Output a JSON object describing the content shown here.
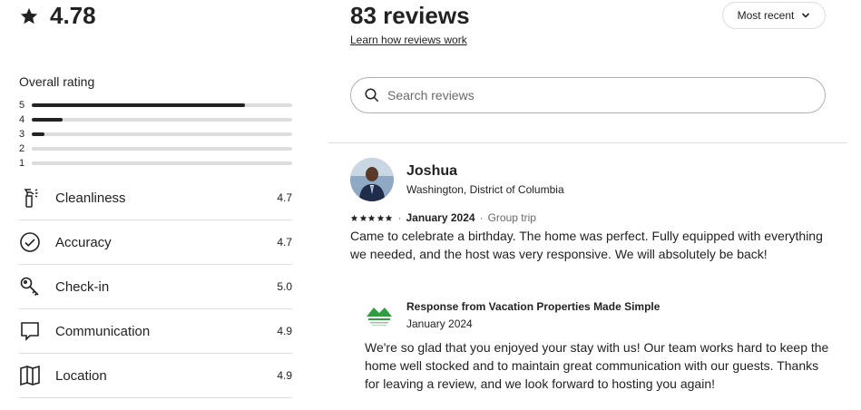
{
  "rating": {
    "value": "4.78",
    "icon": "star-icon"
  },
  "overall": {
    "title": "Overall rating",
    "distribution": [
      {
        "label": "5",
        "fraction": 0.82
      },
      {
        "label": "4",
        "fraction": 0.12
      },
      {
        "label": "3",
        "fraction": 0.05
      },
      {
        "label": "2",
        "fraction": 0.0
      },
      {
        "label": "1",
        "fraction": 0.0
      }
    ]
  },
  "categories": [
    {
      "label": "Cleanliness",
      "score": "4.7",
      "icon": "spray-bottle-icon"
    },
    {
      "label": "Accuracy",
      "score": "4.7",
      "icon": "check-circle-icon"
    },
    {
      "label": "Check-in",
      "score": "5.0",
      "icon": "key-icon"
    },
    {
      "label": "Communication",
      "score": "4.9",
      "icon": "chat-bubble-icon"
    },
    {
      "label": "Location",
      "score": "4.9",
      "icon": "map-icon"
    }
  ],
  "reviews_header": {
    "count": "83 reviews",
    "learn_link": "Learn how reviews work",
    "sort_label": "Most recent"
  },
  "search": {
    "placeholder": "Search reviews"
  },
  "review": {
    "name": "Joshua",
    "location": "Washington, District of Columbia",
    "stars": 5,
    "date": "January 2024",
    "trip": "Group trip",
    "text": "Came to celebrate a birthday. The home was perfect. Fully equipped with everything we needed, and the host was very responsive. We will absolutely be back!",
    "response": {
      "title": "Response from Vacation Properties Made Simple",
      "date": "January 2024",
      "text": "We're so glad that you enjoyed your stay with us! Our team works hard to keep the home well stocked and to maintain great communication with our guests. Thanks for leaving a review, and we look forward to hosting you again!"
    }
  },
  "colors": {
    "text": "#222222",
    "muted": "#6a6a6a",
    "border": "#dddddd",
    "logo_green": "#2e9e3f"
  }
}
